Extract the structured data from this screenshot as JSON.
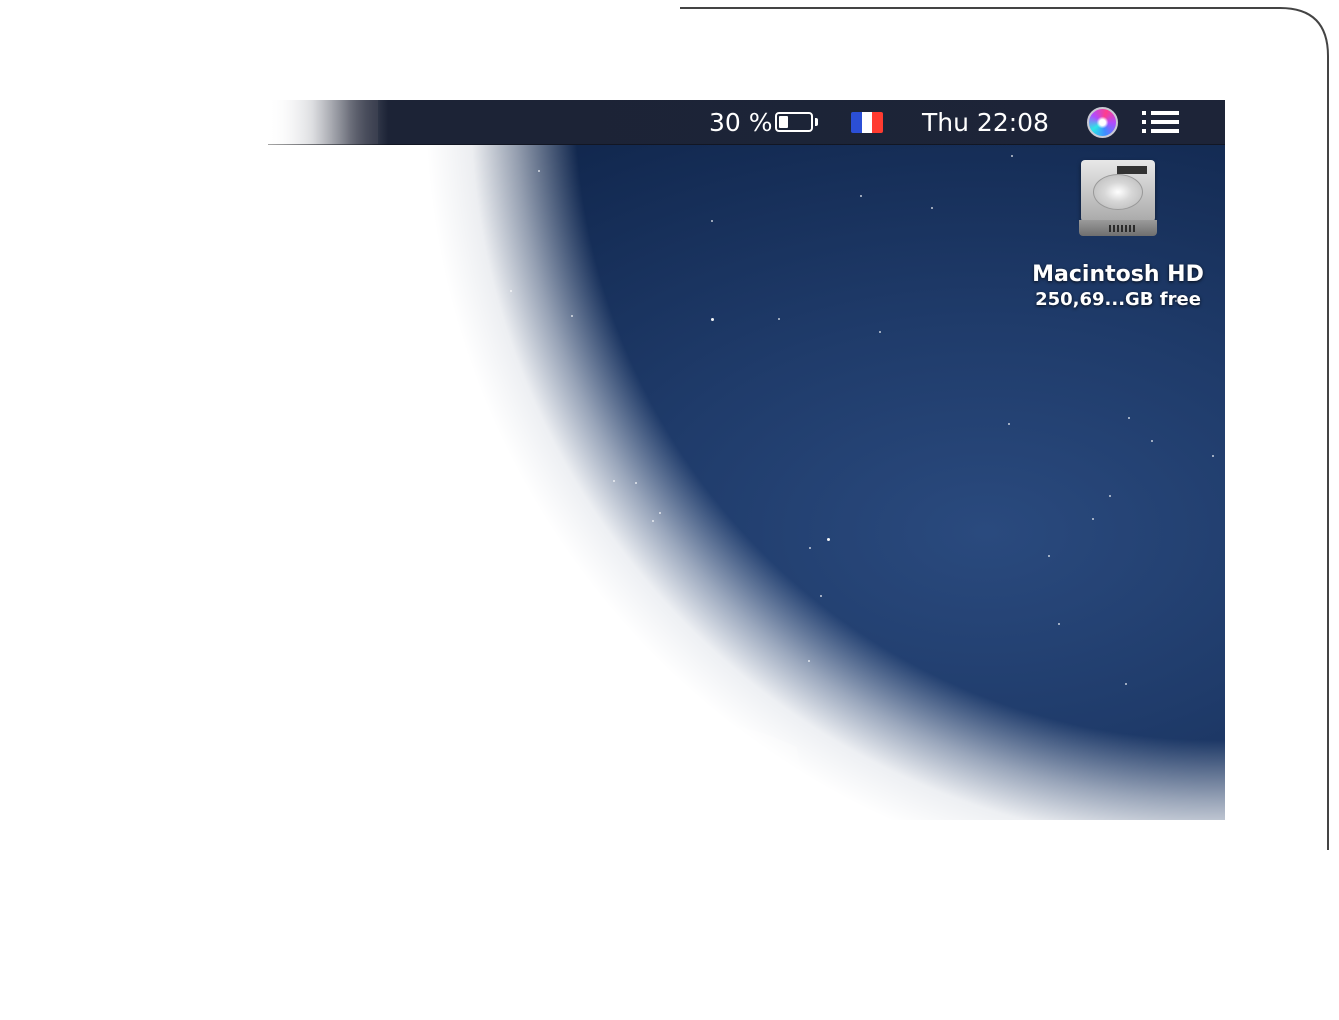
{
  "menubar": {
    "battery_percent": "30 %",
    "battery_level": 0.3,
    "input_source": "flag-france-icon",
    "flag_colors": [
      "#2b4fd6",
      "#ffffff",
      "#ff3b30"
    ],
    "clock": "Thu 22:08",
    "siri": "siri-icon",
    "notification_center": "list-icon"
  },
  "desktop": {
    "drive_name": "Macintosh HD",
    "drive_free": "250,69...GB free"
  },
  "colors": {
    "menubar_bg": "#1d2438",
    "wallpaper": "#1f3b6a"
  }
}
